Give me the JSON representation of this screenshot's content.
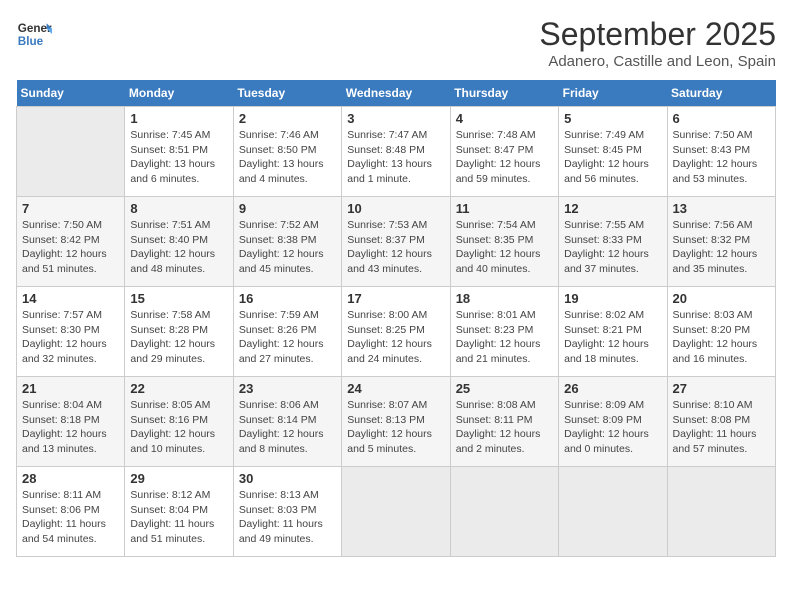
{
  "logo": {
    "line1": "General",
    "line2": "Blue"
  },
  "title": "September 2025",
  "subtitle": "Adanero, Castille and Leon, Spain",
  "weekdays": [
    "Sunday",
    "Monday",
    "Tuesday",
    "Wednesday",
    "Thursday",
    "Friday",
    "Saturday"
  ],
  "weeks": [
    [
      {
        "day": "",
        "info": ""
      },
      {
        "day": "1",
        "info": "Sunrise: 7:45 AM\nSunset: 8:51 PM\nDaylight: 13 hours\nand 6 minutes."
      },
      {
        "day": "2",
        "info": "Sunrise: 7:46 AM\nSunset: 8:50 PM\nDaylight: 13 hours\nand 4 minutes."
      },
      {
        "day": "3",
        "info": "Sunrise: 7:47 AM\nSunset: 8:48 PM\nDaylight: 13 hours\nand 1 minute."
      },
      {
        "day": "4",
        "info": "Sunrise: 7:48 AM\nSunset: 8:47 PM\nDaylight: 12 hours\nand 59 minutes."
      },
      {
        "day": "5",
        "info": "Sunrise: 7:49 AM\nSunset: 8:45 PM\nDaylight: 12 hours\nand 56 minutes."
      },
      {
        "day": "6",
        "info": "Sunrise: 7:50 AM\nSunset: 8:43 PM\nDaylight: 12 hours\nand 53 minutes."
      }
    ],
    [
      {
        "day": "7",
        "info": "Sunrise: 7:50 AM\nSunset: 8:42 PM\nDaylight: 12 hours\nand 51 minutes."
      },
      {
        "day": "8",
        "info": "Sunrise: 7:51 AM\nSunset: 8:40 PM\nDaylight: 12 hours\nand 48 minutes."
      },
      {
        "day": "9",
        "info": "Sunrise: 7:52 AM\nSunset: 8:38 PM\nDaylight: 12 hours\nand 45 minutes."
      },
      {
        "day": "10",
        "info": "Sunrise: 7:53 AM\nSunset: 8:37 PM\nDaylight: 12 hours\nand 43 minutes."
      },
      {
        "day": "11",
        "info": "Sunrise: 7:54 AM\nSunset: 8:35 PM\nDaylight: 12 hours\nand 40 minutes."
      },
      {
        "day": "12",
        "info": "Sunrise: 7:55 AM\nSunset: 8:33 PM\nDaylight: 12 hours\nand 37 minutes."
      },
      {
        "day": "13",
        "info": "Sunrise: 7:56 AM\nSunset: 8:32 PM\nDaylight: 12 hours\nand 35 minutes."
      }
    ],
    [
      {
        "day": "14",
        "info": "Sunrise: 7:57 AM\nSunset: 8:30 PM\nDaylight: 12 hours\nand 32 minutes."
      },
      {
        "day": "15",
        "info": "Sunrise: 7:58 AM\nSunset: 8:28 PM\nDaylight: 12 hours\nand 29 minutes."
      },
      {
        "day": "16",
        "info": "Sunrise: 7:59 AM\nSunset: 8:26 PM\nDaylight: 12 hours\nand 27 minutes."
      },
      {
        "day": "17",
        "info": "Sunrise: 8:00 AM\nSunset: 8:25 PM\nDaylight: 12 hours\nand 24 minutes."
      },
      {
        "day": "18",
        "info": "Sunrise: 8:01 AM\nSunset: 8:23 PM\nDaylight: 12 hours\nand 21 minutes."
      },
      {
        "day": "19",
        "info": "Sunrise: 8:02 AM\nSunset: 8:21 PM\nDaylight: 12 hours\nand 18 minutes."
      },
      {
        "day": "20",
        "info": "Sunrise: 8:03 AM\nSunset: 8:20 PM\nDaylight: 12 hours\nand 16 minutes."
      }
    ],
    [
      {
        "day": "21",
        "info": "Sunrise: 8:04 AM\nSunset: 8:18 PM\nDaylight: 12 hours\nand 13 minutes."
      },
      {
        "day": "22",
        "info": "Sunrise: 8:05 AM\nSunset: 8:16 PM\nDaylight: 12 hours\nand 10 minutes."
      },
      {
        "day": "23",
        "info": "Sunrise: 8:06 AM\nSunset: 8:14 PM\nDaylight: 12 hours\nand 8 minutes."
      },
      {
        "day": "24",
        "info": "Sunrise: 8:07 AM\nSunset: 8:13 PM\nDaylight: 12 hours\nand 5 minutes."
      },
      {
        "day": "25",
        "info": "Sunrise: 8:08 AM\nSunset: 8:11 PM\nDaylight: 12 hours\nand 2 minutes."
      },
      {
        "day": "26",
        "info": "Sunrise: 8:09 AM\nSunset: 8:09 PM\nDaylight: 12 hours\nand 0 minutes."
      },
      {
        "day": "27",
        "info": "Sunrise: 8:10 AM\nSunset: 8:08 PM\nDaylight: 11 hours\nand 57 minutes."
      }
    ],
    [
      {
        "day": "28",
        "info": "Sunrise: 8:11 AM\nSunset: 8:06 PM\nDaylight: 11 hours\nand 54 minutes."
      },
      {
        "day": "29",
        "info": "Sunrise: 8:12 AM\nSunset: 8:04 PM\nDaylight: 11 hours\nand 51 minutes."
      },
      {
        "day": "30",
        "info": "Sunrise: 8:13 AM\nSunset: 8:03 PM\nDaylight: 11 hours\nand 49 minutes."
      },
      {
        "day": "",
        "info": ""
      },
      {
        "day": "",
        "info": ""
      },
      {
        "day": "",
        "info": ""
      },
      {
        "day": "",
        "info": ""
      }
    ]
  ]
}
